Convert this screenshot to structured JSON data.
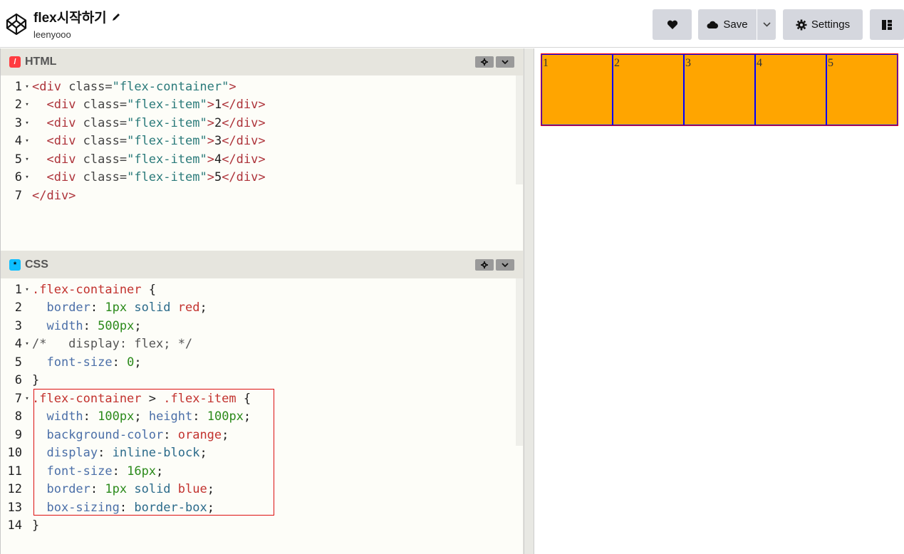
{
  "header": {
    "title": "flex시작하기",
    "owner": "leenyooo",
    "save_label": "Save",
    "settings_label": "Settings"
  },
  "html_editor": {
    "tab_label": "HTML",
    "lines": [
      {
        "n": "1",
        "fold": true,
        "tokens": [
          [
            "t-tag",
            "<div "
          ],
          [
            "t-attr",
            "class="
          ],
          [
            "t-str",
            "\"flex-container\""
          ],
          [
            "t-tag",
            ">"
          ]
        ]
      },
      {
        "n": "2",
        "fold": true,
        "tokens": [
          [
            "t-plain",
            "  "
          ],
          [
            "t-tag",
            "<div "
          ],
          [
            "t-attr",
            "class="
          ],
          [
            "t-str",
            "\"flex-item\""
          ],
          [
            "t-tag",
            ">"
          ],
          [
            "t-plain",
            "1"
          ],
          [
            "t-tag",
            "</div>"
          ]
        ]
      },
      {
        "n": "3",
        "fold": true,
        "tokens": [
          [
            "t-plain",
            "  "
          ],
          [
            "t-tag",
            "<div "
          ],
          [
            "t-attr",
            "class="
          ],
          [
            "t-str",
            "\"flex-item\""
          ],
          [
            "t-tag",
            ">"
          ],
          [
            "t-plain",
            "2"
          ],
          [
            "t-tag",
            "</div>"
          ]
        ]
      },
      {
        "n": "4",
        "fold": true,
        "tokens": [
          [
            "t-plain",
            "  "
          ],
          [
            "t-tag",
            "<div "
          ],
          [
            "t-attr",
            "class="
          ],
          [
            "t-str",
            "\"flex-item\""
          ],
          [
            "t-tag",
            ">"
          ],
          [
            "t-plain",
            "3"
          ],
          [
            "t-tag",
            "</div>"
          ]
        ]
      },
      {
        "n": "5",
        "fold": true,
        "tokens": [
          [
            "t-plain",
            "  "
          ],
          [
            "t-tag",
            "<div "
          ],
          [
            "t-attr",
            "class="
          ],
          [
            "t-str",
            "\"flex-item\""
          ],
          [
            "t-tag",
            ">"
          ],
          [
            "t-plain",
            "4"
          ],
          [
            "t-tag",
            "</div>"
          ]
        ]
      },
      {
        "n": "6",
        "fold": true,
        "tokens": [
          [
            "t-plain",
            "  "
          ],
          [
            "t-tag",
            "<div "
          ],
          [
            "t-attr",
            "class="
          ],
          [
            "t-str",
            "\"flex-item\""
          ],
          [
            "t-tag",
            ">"
          ],
          [
            "t-plain",
            "5"
          ],
          [
            "t-tag",
            "</div>"
          ]
        ]
      },
      {
        "n": "7",
        "fold": false,
        "tokens": [
          [
            "t-tag",
            "</div>"
          ]
        ]
      }
    ]
  },
  "css_editor": {
    "tab_label": "CSS",
    "lines": [
      {
        "n": "1",
        "fold": true,
        "tokens": [
          [
            "t-sel",
            ".flex-container"
          ],
          [
            "t-plain",
            " {"
          ]
        ]
      },
      {
        "n": "2",
        "fold": false,
        "tokens": [
          [
            "t-plain",
            "  "
          ],
          [
            "t-prop",
            "border"
          ],
          [
            "t-plain",
            ": "
          ],
          [
            "t-num",
            "1px"
          ],
          [
            "t-plain",
            " "
          ],
          [
            "t-val",
            "solid"
          ],
          [
            "t-plain",
            " "
          ],
          [
            "t-kw",
            "red"
          ],
          [
            "t-plain",
            ";"
          ]
        ]
      },
      {
        "n": "3",
        "fold": false,
        "tokens": [
          [
            "t-plain",
            "  "
          ],
          [
            "t-prop",
            "width"
          ],
          [
            "t-plain",
            ": "
          ],
          [
            "t-num",
            "500px"
          ],
          [
            "t-plain",
            ";"
          ]
        ]
      },
      {
        "n": "4",
        "fold": true,
        "tokens": [
          [
            "t-comment",
            "/*   display: flex; */"
          ]
        ]
      },
      {
        "n": "5",
        "fold": false,
        "tokens": [
          [
            "t-plain",
            "  "
          ],
          [
            "t-prop",
            "font-size"
          ],
          [
            "t-plain",
            ": "
          ],
          [
            "t-num",
            "0"
          ],
          [
            "t-plain",
            ";"
          ]
        ]
      },
      {
        "n": "6",
        "fold": false,
        "tokens": [
          [
            "t-plain",
            "}"
          ]
        ]
      },
      {
        "n": "7",
        "fold": true,
        "tokens": [
          [
            "t-sel",
            ".flex-container"
          ],
          [
            "t-plain",
            " > "
          ],
          [
            "t-sel",
            ".flex-item"
          ],
          [
            "t-plain",
            " {"
          ]
        ]
      },
      {
        "n": "8",
        "fold": false,
        "tokens": [
          [
            "t-plain",
            "  "
          ],
          [
            "t-prop",
            "width"
          ],
          [
            "t-plain",
            ": "
          ],
          [
            "t-num",
            "100px"
          ],
          [
            "t-plain",
            "; "
          ],
          [
            "t-prop",
            "height"
          ],
          [
            "t-plain",
            ": "
          ],
          [
            "t-num",
            "100px"
          ],
          [
            "t-plain",
            ";"
          ]
        ]
      },
      {
        "n": "9",
        "fold": false,
        "tokens": [
          [
            "t-plain",
            "  "
          ],
          [
            "t-prop",
            "background-color"
          ],
          [
            "t-plain",
            ": "
          ],
          [
            "t-kw",
            "orange"
          ],
          [
            "t-plain",
            ";"
          ]
        ]
      },
      {
        "n": "10",
        "fold": false,
        "tokens": [
          [
            "t-plain",
            "  "
          ],
          [
            "t-prop",
            "display"
          ],
          [
            "t-plain",
            ": "
          ],
          [
            "t-val",
            "inline-block"
          ],
          [
            "t-plain",
            ";"
          ]
        ]
      },
      {
        "n": "11",
        "fold": false,
        "tokens": [
          [
            "t-plain",
            "  "
          ],
          [
            "t-prop",
            "font-size"
          ],
          [
            "t-plain",
            ": "
          ],
          [
            "t-num",
            "16px"
          ],
          [
            "t-plain",
            ";"
          ]
        ]
      },
      {
        "n": "12",
        "fold": false,
        "tokens": [
          [
            "t-plain",
            "  "
          ],
          [
            "t-prop",
            "border"
          ],
          [
            "t-plain",
            ": "
          ],
          [
            "t-num",
            "1px"
          ],
          [
            "t-plain",
            " "
          ],
          [
            "t-val",
            "solid"
          ],
          [
            "t-plain",
            " "
          ],
          [
            "t-kw",
            "blue"
          ],
          [
            "t-plain",
            ";"
          ]
        ]
      },
      {
        "n": "13",
        "fold": false,
        "tokens": [
          [
            "t-plain",
            "  "
          ],
          [
            "t-prop",
            "box-sizing"
          ],
          [
            "t-plain",
            ": "
          ],
          [
            "t-val",
            "border-box"
          ],
          [
            "t-plain",
            ";"
          ]
        ]
      },
      {
        "n": "14",
        "fold": false,
        "tokens": [
          [
            "t-plain",
            "}"
          ]
        ]
      }
    ]
  },
  "preview": {
    "items": [
      "1",
      "2",
      "3",
      "4",
      "5"
    ]
  },
  "colors": {
    "item_bg": "#ffa500",
    "item_border": "#0000ff",
    "container_border": "#ff0000",
    "annotation_box": "#dd1111"
  }
}
